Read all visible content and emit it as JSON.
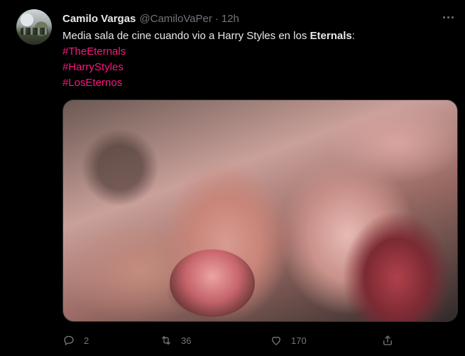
{
  "tweet": {
    "author_name": "Camilo Vargas",
    "author_handle": "@CamiloVaPer",
    "separator": "·",
    "time": "12h",
    "text_prefix": "Media sala de cine cuando vio a Harry Styles en los ",
    "text_bold": "Eternals",
    "text_suffix": ":",
    "hashtags": [
      "#TheEternals",
      "#HarryStyles",
      "#LosEternos"
    ]
  },
  "actions": {
    "reply_count": "2",
    "retweet_count": "36",
    "like_count": "170"
  },
  "icons": {
    "more": "more-horizontal-icon",
    "reply": "reply-icon",
    "retweet": "retweet-icon",
    "like": "heart-icon",
    "share": "share-icon"
  },
  "colors": {
    "background": "#000000",
    "text": "#e7e9ea",
    "muted": "#71767b",
    "hashtag": "#f91880"
  }
}
